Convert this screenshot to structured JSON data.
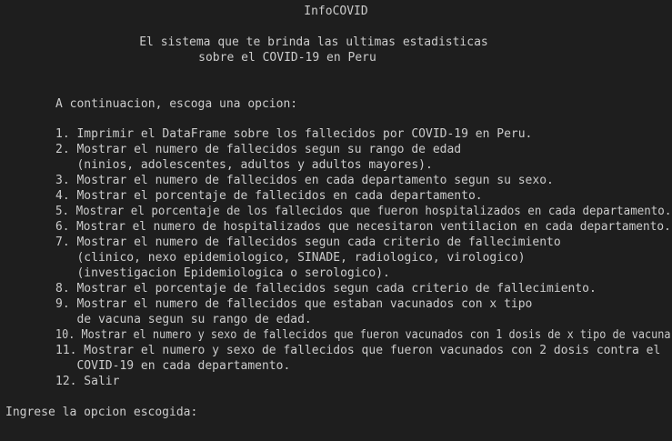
{
  "header": {
    "title": "InfoCOVID",
    "subtitle_line1": "El sistema que te brinda las ultimas estadisticas",
    "subtitle_line2": "sobre el COVID-19 en Peru"
  },
  "menu": {
    "prompt": "A continuacion, escoga una opcion:",
    "lines": [
      "1. Imprimir el DataFrame sobre los fallecidos por COVID-19 en Peru.",
      "2. Mostrar el numero de fallecidos segun su rango de edad",
      "   (ninios, adolescentes, adultos y adultos mayores).",
      "3. Mostrar el numero de fallecidos en cada departamento segun su sexo.",
      "4. Mostrar el porcentaje de fallecidos en cada departamento.",
      "5. Mostrar el porcentaje de los fallecidos que fueron hospitalizados en cada departamento.",
      "6. Mostrar el numero de hospitalizados que necesitaron ventilacion en cada departamento.",
      "7. Mostrar el numero de fallecidos segun cada criterio de fallecimiento",
      "   (clinico, nexo epidemiologico, SINADE, radiologico, virologico)",
      "   (investigacion Epidemiologica o serologico).",
      "8. Mostrar el porcentaje de fallecidos segun cada criterio de fallecimiento.",
      "9. Mostrar el numero de fallecidos que estaban vacunados con x tipo",
      "   de vacuna segun su rango de edad.",
      "10. Mostrar el numero y sexo de fallecidos que fueron vacunados con 1 dosis de x tipo de vacuna",
      "11. Mostrar el numero y sexo de fallecidos que fueron vacunados con 2 dosis contra el",
      "   COVID-19 en cada departamento.",
      "12. Salir"
    ]
  },
  "input": {
    "prompt": "Ingrese la opcion escogida:"
  },
  "colors": {
    "background": "#1e1e1e",
    "text": "#cccccc"
  }
}
